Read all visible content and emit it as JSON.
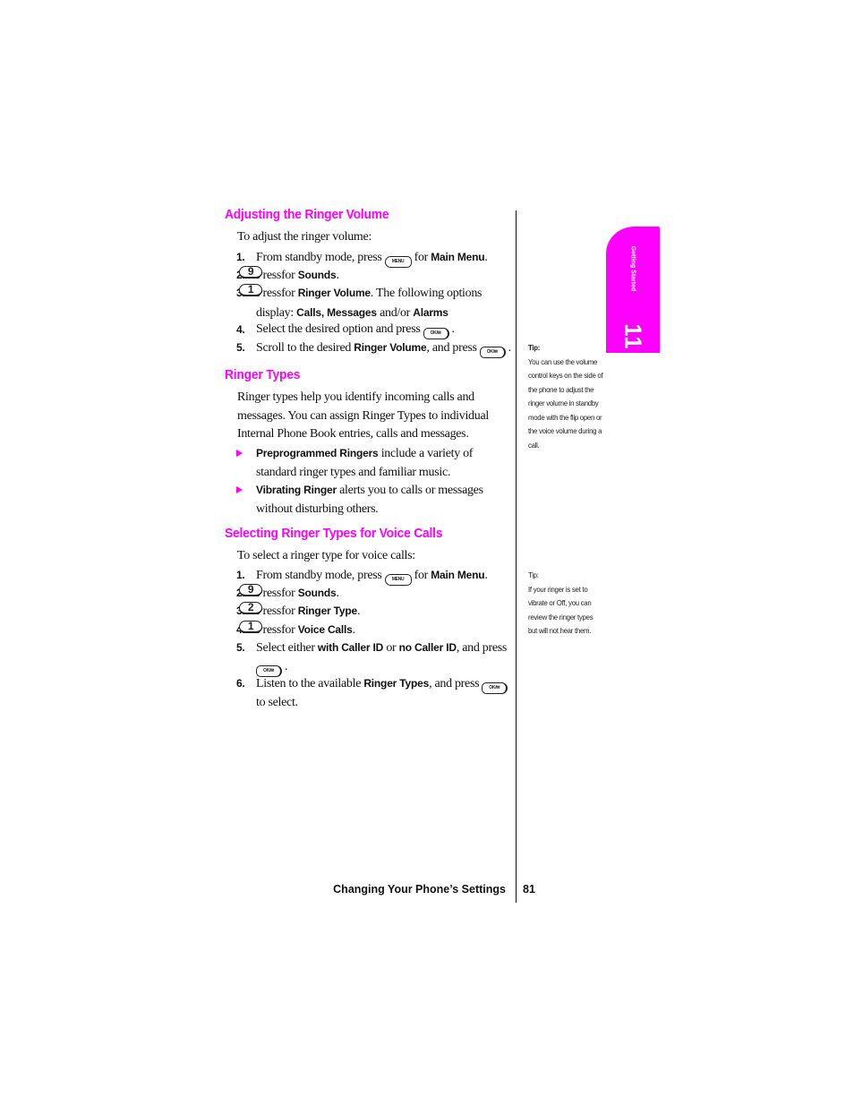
{
  "sections": {
    "volume": {
      "title": "Adjusting the Ringer Volume",
      "intro": "To adjust the ringer volume:",
      "steps": [
        {
          "num": "1.",
          "pre": "From standby mode, press",
          "key": "MENU",
          "mid": "for",
          "bold": "Main Menu",
          "post": "."
        },
        {
          "num": "2.",
          "pre": "Press",
          "key": "9",
          "mid": "for",
          "bold": "Sounds",
          "post": "."
        },
        {
          "num": "3.",
          "pre": "Press",
          "key": "1",
          "mid": "for",
          "bold": "Ringer Volume",
          "post": ". The following options display:",
          "bold2": "Calls, Messages",
          "mid2": "and/or",
          "bold3": "Alarms"
        },
        {
          "num": "4.",
          "pre": "Select the desired option and press",
          "key": "OK/✉",
          "post": "."
        },
        {
          "num": "5.",
          "pre": "Scroll to the desired",
          "bold": "Ringer Volume",
          "mid": ", and press",
          "key": "OK/✉",
          "post": "."
        }
      ]
    },
    "types": {
      "title": "Ringer Types",
      "paragraph": "Ringer types help you identify incoming calls and messages. You can assign Ringer Types to individual Internal Phone Book entries, calls and messages.",
      "bullets": [
        {
          "bold": "Preprogrammed Ringers",
          "text": "include a variety of standard ringer types and familiar music."
        },
        {
          "bold": "Vibrating Ringer",
          "text": "alerts you to calls or messages without disturbing others."
        }
      ]
    },
    "voice": {
      "title": "Selecting Ringer Types for Voice Calls",
      "intro": "To select a ringer type for voice calls:",
      "steps": [
        {
          "num": "1.",
          "pre": "From standby mode, press",
          "key": "MENU",
          "mid": "for",
          "bold": "Main Menu",
          "post": "."
        },
        {
          "num": "2.",
          "pre": "Press",
          "key": "9",
          "mid": "for",
          "bold": "Sounds",
          "post": "."
        },
        {
          "num": "3.",
          "pre": "Press",
          "key": "2",
          "mid": "for",
          "bold": "Ringer Type",
          "post": "."
        },
        {
          "num": "4.",
          "pre": "Press",
          "key": "1",
          "mid": "for",
          "bold": "Voice Calls",
          "post": "."
        },
        {
          "num": "5.",
          "pre": "Select either",
          "bold": "with Caller ID",
          "mid": "or",
          "bold2": "no Caller ID",
          "mid2": ", and press",
          "key": "OK/✉",
          "post": "."
        },
        {
          "num": "6.",
          "pre": "Listen to the available",
          "bold": "Ringer Types",
          "mid": ", and press",
          "key": "OK/✉",
          "post": "to select."
        }
      ]
    }
  },
  "sidebar": {
    "tab_label": "Getting Started",
    "tab_number": "11",
    "tips": [
      {
        "heading": "Tip:",
        "text": [
          "You can use the volume",
          "control keys on the side of",
          "the phone to adjust the",
          "ringer volume in standby",
          "mode with the flip open or",
          "the voice volume during a",
          "call."
        ]
      },
      {
        "heading": "Tip:",
        "text": [
          "If your ringer is set to",
          "vibrate or Off, you can",
          "review the ringer types",
          "but will not hear them."
        ]
      }
    ]
  },
  "footer": {
    "section_title": "Changing Your Phone’s Settings",
    "page_number": "81"
  },
  "colors": {
    "accent": "#ff00ff",
    "text": "#111111"
  }
}
